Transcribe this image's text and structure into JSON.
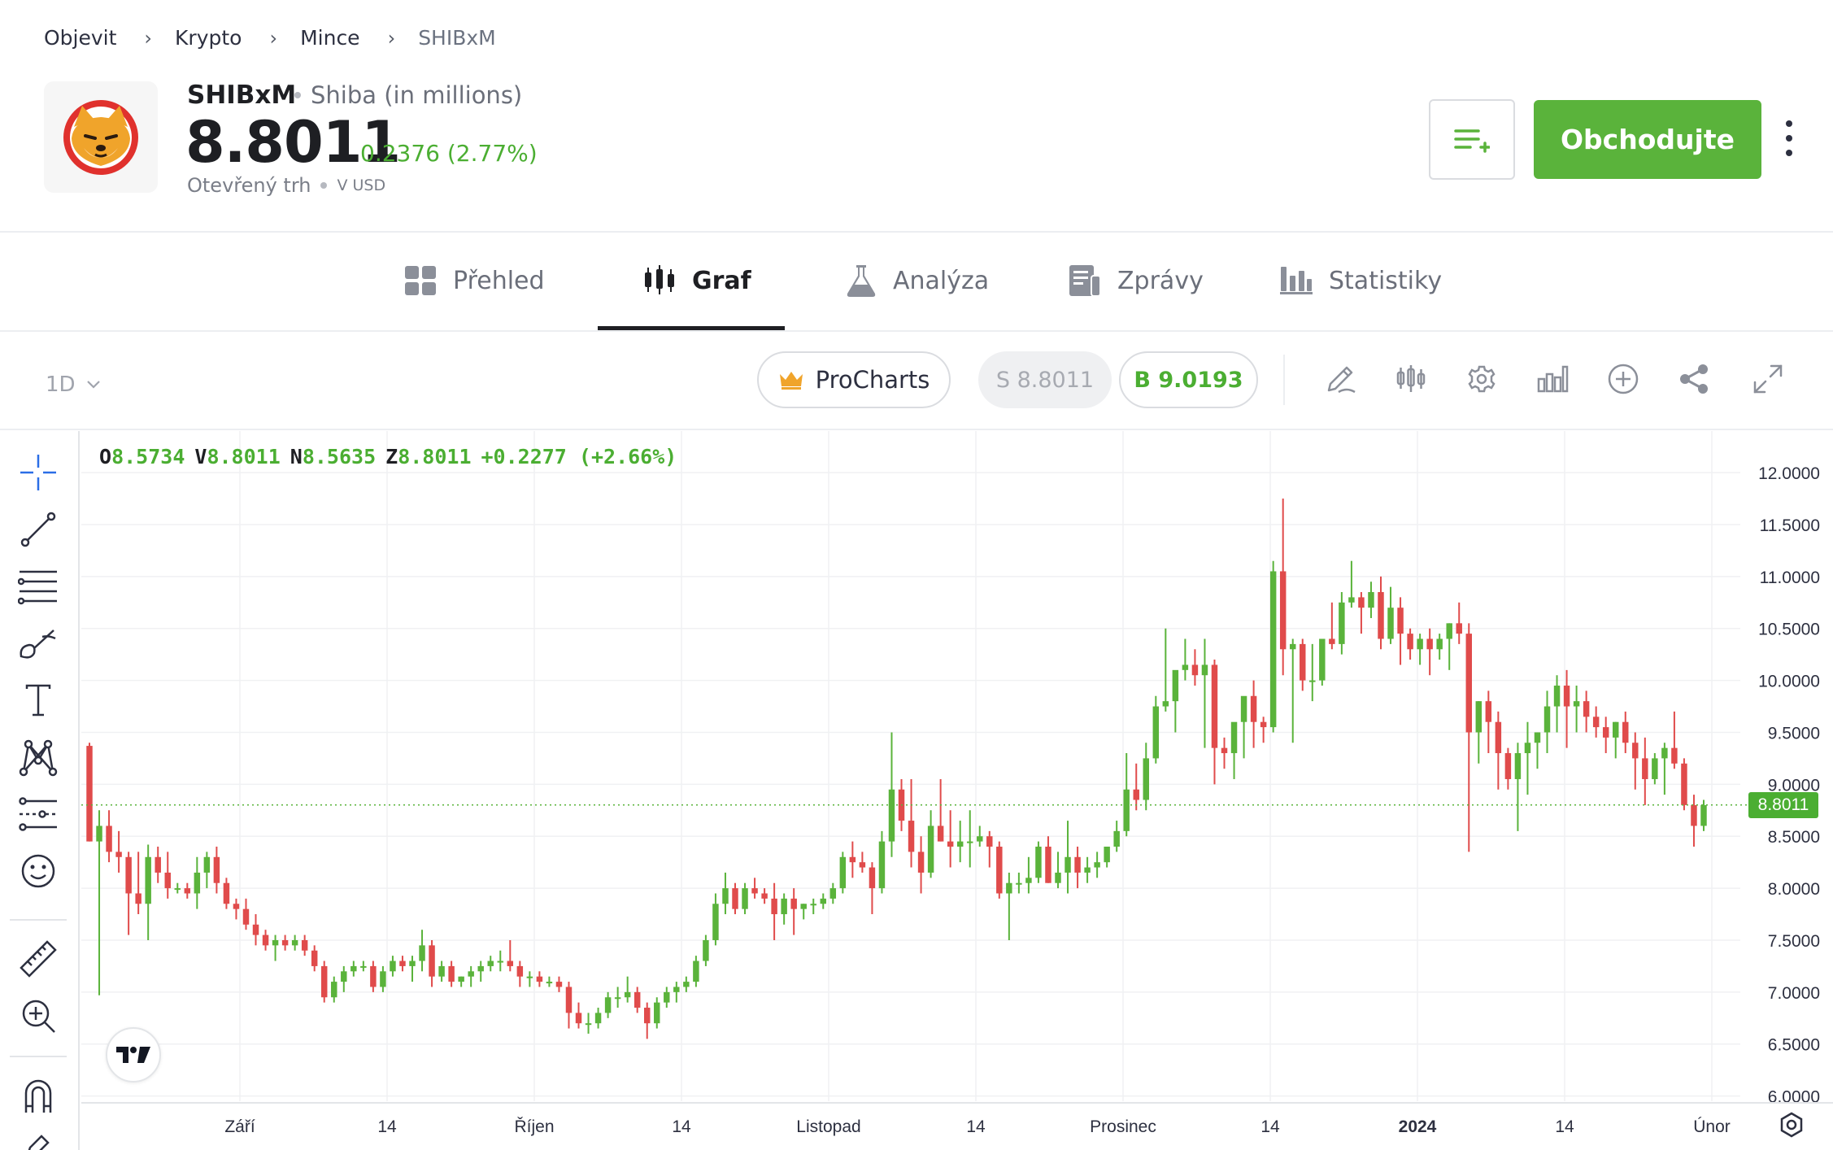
{
  "breadcrumb": [
    "Objevit",
    "Krypto",
    "Mince",
    "SHIBxM"
  ],
  "instrument": {
    "symbol": "SHIBxM",
    "name": "Shiba (in millions)",
    "price": "8.8011",
    "change": "0.2376 (2.77%)",
    "market_status": "Otevřený trh",
    "currency": "V USD",
    "logo": "shiba-inu-logo"
  },
  "actions": {
    "watchlist_icon": "add-to-watchlist-icon",
    "trade_label": "Obchodujte",
    "more_icon": "more-vertical-icon"
  },
  "tabs": [
    {
      "label": "Přehled",
      "icon": "grid-icon",
      "active": false
    },
    {
      "label": "Graf",
      "icon": "candles-icon",
      "active": true
    },
    {
      "label": "Analýza",
      "icon": "flask-icon",
      "active": false
    },
    {
      "label": "Zprávy",
      "icon": "news-icon",
      "active": false
    },
    {
      "label": "Statistiky",
      "icon": "bar-chart-icon",
      "active": false
    }
  ],
  "chart_toolbar": {
    "interval": "1D",
    "procharts_label": "ProCharts",
    "sell_label": "S 8.8011",
    "buy_label": "B 9.0193",
    "icons": [
      "pencil-icon",
      "indicators-icon",
      "settings-icon",
      "chart-type-icon",
      "add-icon",
      "share-icon",
      "fullscreen-icon"
    ]
  },
  "left_tools": [
    "crosshair-icon",
    "trend-line-icon",
    "fib-lines-icon",
    "brush-icon",
    "text-icon",
    "pattern-icon",
    "prediction-icon",
    "emoji-icon",
    "ruler-icon",
    "zoom-in-icon",
    "magnet-icon",
    "pencil-lock-icon"
  ],
  "ohlc": {
    "o_label": "O",
    "o": "8.5734",
    "h_label": "V",
    "h": "8.8011",
    "l_label": "N",
    "l": "8.5635",
    "c_label": "Z",
    "c": "8.8011",
    "chg": "+0.2277 (+2.66%)"
  },
  "colors": {
    "up": "#5ab33b",
    "down": "#e04b4b",
    "accent": "#5ab33b"
  },
  "chart_data": {
    "type": "candlestick",
    "current_price": "8.8011",
    "y_ticks": [
      "12.0000",
      "11.5000",
      "11.0000",
      "10.5000",
      "10.0000",
      "9.5000",
      "9.0000",
      "8.5000",
      "8.0000",
      "7.5000",
      "7.0000",
      "6.5000",
      "6.0000"
    ],
    "x_ticks": [
      {
        "label": "Září",
        "bold": false
      },
      {
        "label": "14",
        "bold": false
      },
      {
        "label": "Říjen",
        "bold": false
      },
      {
        "label": "14",
        "bold": false
      },
      {
        "label": "Listopad",
        "bold": false
      },
      {
        "label": "14",
        "bold": false
      },
      {
        "label": "Prosinec",
        "bold": false
      },
      {
        "label": "14",
        "bold": false
      },
      {
        "label": "2024",
        "bold": true
      },
      {
        "label": "14",
        "bold": false
      },
      {
        "label": "Únor",
        "bold": false
      }
    ],
    "ylim": [
      5.95,
      12.4
    ],
    "candles": [
      [
        9.37,
        9.4,
        8.45,
        8.45
      ],
      [
        8.45,
        8.75,
        6.97,
        8.6
      ],
      [
        8.6,
        8.75,
        8.25,
        8.35
      ],
      [
        8.35,
        8.55,
        8.15,
        8.3
      ],
      [
        8.3,
        8.35,
        7.55,
        7.95
      ],
      [
        7.95,
        8.35,
        7.75,
        7.85
      ],
      [
        7.85,
        8.42,
        7.5,
        8.3
      ],
      [
        8.3,
        8.4,
        8.05,
        8.15
      ],
      [
        8.15,
        8.35,
        7.9,
        8.0
      ],
      [
        8.0,
        8.05,
        7.95,
        8.0
      ],
      [
        8.0,
        8.05,
        7.9,
        7.95
      ],
      [
        7.95,
        8.3,
        7.8,
        8.15
      ],
      [
        8.15,
        8.35,
        8.0,
        8.3
      ],
      [
        8.3,
        8.4,
        7.95,
        8.05
      ],
      [
        8.05,
        8.1,
        7.8,
        7.85
      ],
      [
        7.85,
        7.9,
        7.7,
        7.8
      ],
      [
        7.8,
        7.9,
        7.6,
        7.65
      ],
      [
        7.65,
        7.75,
        7.45,
        7.55
      ],
      [
        7.55,
        7.6,
        7.4,
        7.45
      ],
      [
        7.45,
        7.55,
        7.3,
        7.5
      ],
      [
        7.5,
        7.55,
        7.4,
        7.45
      ],
      [
        7.45,
        7.55,
        7.4,
        7.5
      ],
      [
        7.5,
        7.55,
        7.35,
        7.4
      ],
      [
        7.4,
        7.45,
        7.2,
        7.25
      ],
      [
        7.25,
        7.3,
        6.9,
        6.95
      ],
      [
        6.95,
        7.15,
        6.9,
        7.1
      ],
      [
        7.1,
        7.25,
        7.0,
        7.2
      ],
      [
        7.2,
        7.3,
        7.15,
        7.25
      ],
      [
        7.25,
        7.3,
        7.2,
        7.25
      ],
      [
        7.25,
        7.3,
        7.0,
        7.05
      ],
      [
        7.05,
        7.25,
        7.0,
        7.2
      ],
      [
        7.2,
        7.35,
        7.15,
        7.3
      ],
      [
        7.3,
        7.35,
        7.2,
        7.25
      ],
      [
        7.25,
        7.35,
        7.1,
        7.3
      ],
      [
        7.3,
        7.6,
        7.2,
        7.45
      ],
      [
        7.45,
        7.5,
        7.05,
        7.15
      ],
      [
        7.15,
        7.3,
        7.1,
        7.25
      ],
      [
        7.25,
        7.3,
        7.05,
        7.1
      ],
      [
        7.1,
        7.15,
        7.05,
        7.15
      ],
      [
        7.15,
        7.25,
        7.05,
        7.2
      ],
      [
        7.2,
        7.3,
        7.1,
        7.25
      ],
      [
        7.25,
        7.35,
        7.2,
        7.3
      ],
      [
        7.3,
        7.4,
        7.2,
        7.3
      ],
      [
        7.3,
        7.5,
        7.2,
        7.25
      ],
      [
        7.25,
        7.3,
        7.05,
        7.15
      ],
      [
        7.15,
        7.2,
        7.05,
        7.15
      ],
      [
        7.15,
        7.2,
        7.05,
        7.1
      ],
      [
        7.1,
        7.15,
        7.05,
        7.1
      ],
      [
        7.1,
        7.15,
        7.0,
        7.05
      ],
      [
        7.05,
        7.1,
        6.65,
        6.8
      ],
      [
        6.8,
        6.9,
        6.65,
        6.7
      ],
      [
        6.7,
        6.8,
        6.6,
        6.7
      ],
      [
        6.7,
        6.85,
        6.65,
        6.8
      ],
      [
        6.8,
        7.0,
        6.75,
        6.95
      ],
      [
        6.95,
        7.05,
        6.85,
        6.95
      ],
      [
        6.95,
        7.15,
        6.9,
        7.0
      ],
      [
        7.0,
        7.05,
        6.8,
        6.85
      ],
      [
        6.85,
        6.9,
        6.55,
        6.7
      ],
      [
        6.7,
        6.95,
        6.65,
        6.9
      ],
      [
        6.9,
        7.05,
        6.85,
        7.0
      ],
      [
        7.0,
        7.1,
        6.9,
        7.05
      ],
      [
        7.05,
        7.15,
        7.0,
        7.1
      ],
      [
        7.1,
        7.35,
        7.05,
        7.3
      ],
      [
        7.3,
        7.55,
        7.25,
        7.5
      ],
      [
        7.5,
        7.95,
        7.45,
        7.85
      ],
      [
        7.85,
        8.15,
        7.75,
        8.0
      ],
      [
        8.0,
        8.05,
        7.75,
        7.8
      ],
      [
        7.8,
        8.05,
        7.75,
        8.0
      ],
      [
        8.0,
        8.1,
        7.9,
        7.95
      ],
      [
        7.95,
        8.0,
        7.85,
        7.9
      ],
      [
        7.9,
        8.05,
        7.5,
        7.75
      ],
      [
        7.75,
        7.95,
        7.65,
        7.9
      ],
      [
        7.9,
        8.0,
        7.55,
        7.8
      ],
      [
        7.8,
        7.85,
        7.7,
        7.85
      ],
      [
        7.85,
        7.9,
        7.75,
        7.85
      ],
      [
        7.85,
        7.95,
        7.8,
        7.9
      ],
      [
        7.9,
        8.05,
        7.85,
        8.0
      ],
      [
        8.0,
        8.35,
        7.95,
        8.3
      ],
      [
        8.3,
        8.45,
        8.1,
        8.25
      ],
      [
        8.25,
        8.35,
        8.15,
        8.2
      ],
      [
        8.2,
        8.25,
        7.75,
        8.0
      ],
      [
        8.0,
        8.55,
        7.95,
        8.45
      ],
      [
        8.45,
        9.5,
        8.3,
        8.95
      ],
      [
        8.95,
        9.05,
        8.55,
        8.65
      ],
      [
        8.65,
        9.05,
        8.2,
        8.35
      ],
      [
        8.35,
        8.5,
        7.95,
        8.15
      ],
      [
        8.15,
        8.75,
        8.1,
        8.6
      ],
      [
        8.6,
        9.05,
        8.45,
        8.45
      ],
      [
        8.45,
        8.75,
        8.2,
        8.4
      ],
      [
        8.4,
        8.65,
        8.25,
        8.45
      ],
      [
        8.45,
        8.75,
        8.2,
        8.45
      ],
      [
        8.45,
        8.6,
        8.4,
        8.5
      ],
      [
        8.5,
        8.55,
        8.2,
        8.4
      ],
      [
        8.4,
        8.45,
        7.9,
        7.95
      ],
      [
        7.95,
        8.15,
        7.5,
        8.05
      ],
      [
        8.05,
        8.15,
        7.95,
        8.05
      ],
      [
        8.05,
        8.3,
        7.95,
        8.1
      ],
      [
        8.1,
        8.45,
        8.05,
        8.4
      ],
      [
        8.4,
        8.5,
        8.05,
        8.05
      ],
      [
        8.05,
        8.35,
        8.0,
        8.15
      ],
      [
        8.15,
        8.65,
        7.95,
        8.3
      ],
      [
        8.3,
        8.4,
        8.0,
        8.15
      ],
      [
        8.15,
        8.3,
        8.05,
        8.2
      ],
      [
        8.2,
        8.35,
        8.1,
        8.25
      ],
      [
        8.25,
        8.4,
        8.2,
        8.4
      ],
      [
        8.4,
        8.65,
        8.35,
        8.55
      ],
      [
        8.55,
        9.3,
        8.5,
        8.95
      ],
      [
        8.95,
        9.2,
        8.75,
        8.85
      ],
      [
        8.85,
        9.4,
        8.75,
        9.25
      ],
      [
        9.25,
        9.85,
        9.2,
        9.75
      ],
      [
        9.75,
        10.5,
        9.7,
        9.8
      ],
      [
        9.8,
        10.05,
        9.5,
        10.1
      ],
      [
        10.1,
        10.4,
        10.0,
        10.15
      ],
      [
        10.15,
        10.3,
        9.95,
        10.05
      ],
      [
        10.05,
        10.4,
        9.35,
        10.15
      ],
      [
        10.15,
        10.2,
        9.0,
        9.35
      ],
      [
        9.35,
        9.45,
        9.15,
        9.3
      ],
      [
        9.3,
        9.5,
        9.05,
        9.6
      ],
      [
        9.6,
        9.8,
        9.25,
        9.85
      ],
      [
        9.85,
        10.0,
        9.35,
        9.6
      ],
      [
        9.6,
        9.65,
        9.4,
        9.55
      ],
      [
        9.55,
        11.15,
        9.5,
        11.05
      ],
      [
        11.05,
        11.75,
        10.05,
        10.3
      ],
      [
        10.3,
        10.4,
        9.4,
        10.35
      ],
      [
        10.35,
        10.4,
        9.9,
        10.0
      ],
      [
        10.0,
        10.35,
        9.8,
        10.0
      ],
      [
        10.0,
        10.4,
        9.95,
        10.4
      ],
      [
        10.4,
        10.75,
        10.3,
        10.35
      ],
      [
        10.35,
        10.85,
        10.25,
        10.75
      ],
      [
        10.75,
        11.15,
        10.7,
        10.8
      ],
      [
        10.8,
        10.85,
        10.45,
        10.7
      ],
      [
        10.7,
        10.95,
        10.6,
        10.85
      ],
      [
        10.85,
        11.0,
        10.3,
        10.4
      ],
      [
        10.4,
        10.9,
        10.35,
        10.7
      ],
      [
        10.7,
        10.8,
        10.15,
        10.45
      ],
      [
        10.45,
        10.5,
        10.2,
        10.3
      ],
      [
        10.3,
        10.45,
        10.15,
        10.4
      ],
      [
        10.4,
        10.5,
        10.05,
        10.3
      ],
      [
        10.3,
        10.45,
        10.2,
        10.4
      ],
      [
        10.4,
        10.55,
        10.1,
        10.55
      ],
      [
        10.55,
        10.75,
        10.35,
        10.45
      ],
      [
        10.45,
        10.55,
        8.35,
        9.5
      ],
      [
        9.5,
        9.8,
        9.2,
        9.8
      ],
      [
        9.8,
        9.9,
        9.3,
        9.6
      ],
      [
        9.6,
        9.7,
        8.95,
        9.3
      ],
      [
        9.3,
        9.35,
        8.95,
        9.05
      ],
      [
        9.05,
        9.4,
        8.55,
        9.3
      ],
      [
        9.3,
        9.6,
        8.9,
        9.4
      ],
      [
        9.4,
        9.5,
        9.15,
        9.5
      ],
      [
        9.5,
        9.9,
        9.3,
        9.75
      ],
      [
        9.75,
        10.05,
        9.5,
        9.95
      ],
      [
        9.95,
        10.1,
        9.35,
        9.75
      ],
      [
        9.75,
        9.95,
        9.5,
        9.8
      ],
      [
        9.8,
        9.9,
        9.5,
        9.65
      ],
      [
        9.65,
        9.75,
        9.45,
        9.55
      ],
      [
        9.55,
        9.65,
        9.3,
        9.45
      ],
      [
        9.45,
        9.6,
        9.25,
        9.6
      ],
      [
        9.6,
        9.7,
        9.3,
        9.4
      ],
      [
        9.4,
        9.5,
        8.95,
        9.25
      ],
      [
        9.25,
        9.45,
        8.8,
        9.05
      ],
      [
        9.05,
        9.3,
        9.0,
        9.25
      ],
      [
        9.25,
        9.4,
        8.9,
        9.35
      ],
      [
        9.35,
        9.7,
        9.15,
        9.2
      ],
      [
        9.2,
        9.25,
        8.75,
        8.8
      ],
      [
        8.8,
        8.9,
        8.4,
        8.6
      ],
      [
        8.6,
        8.85,
        8.55,
        8.8
      ]
    ]
  }
}
